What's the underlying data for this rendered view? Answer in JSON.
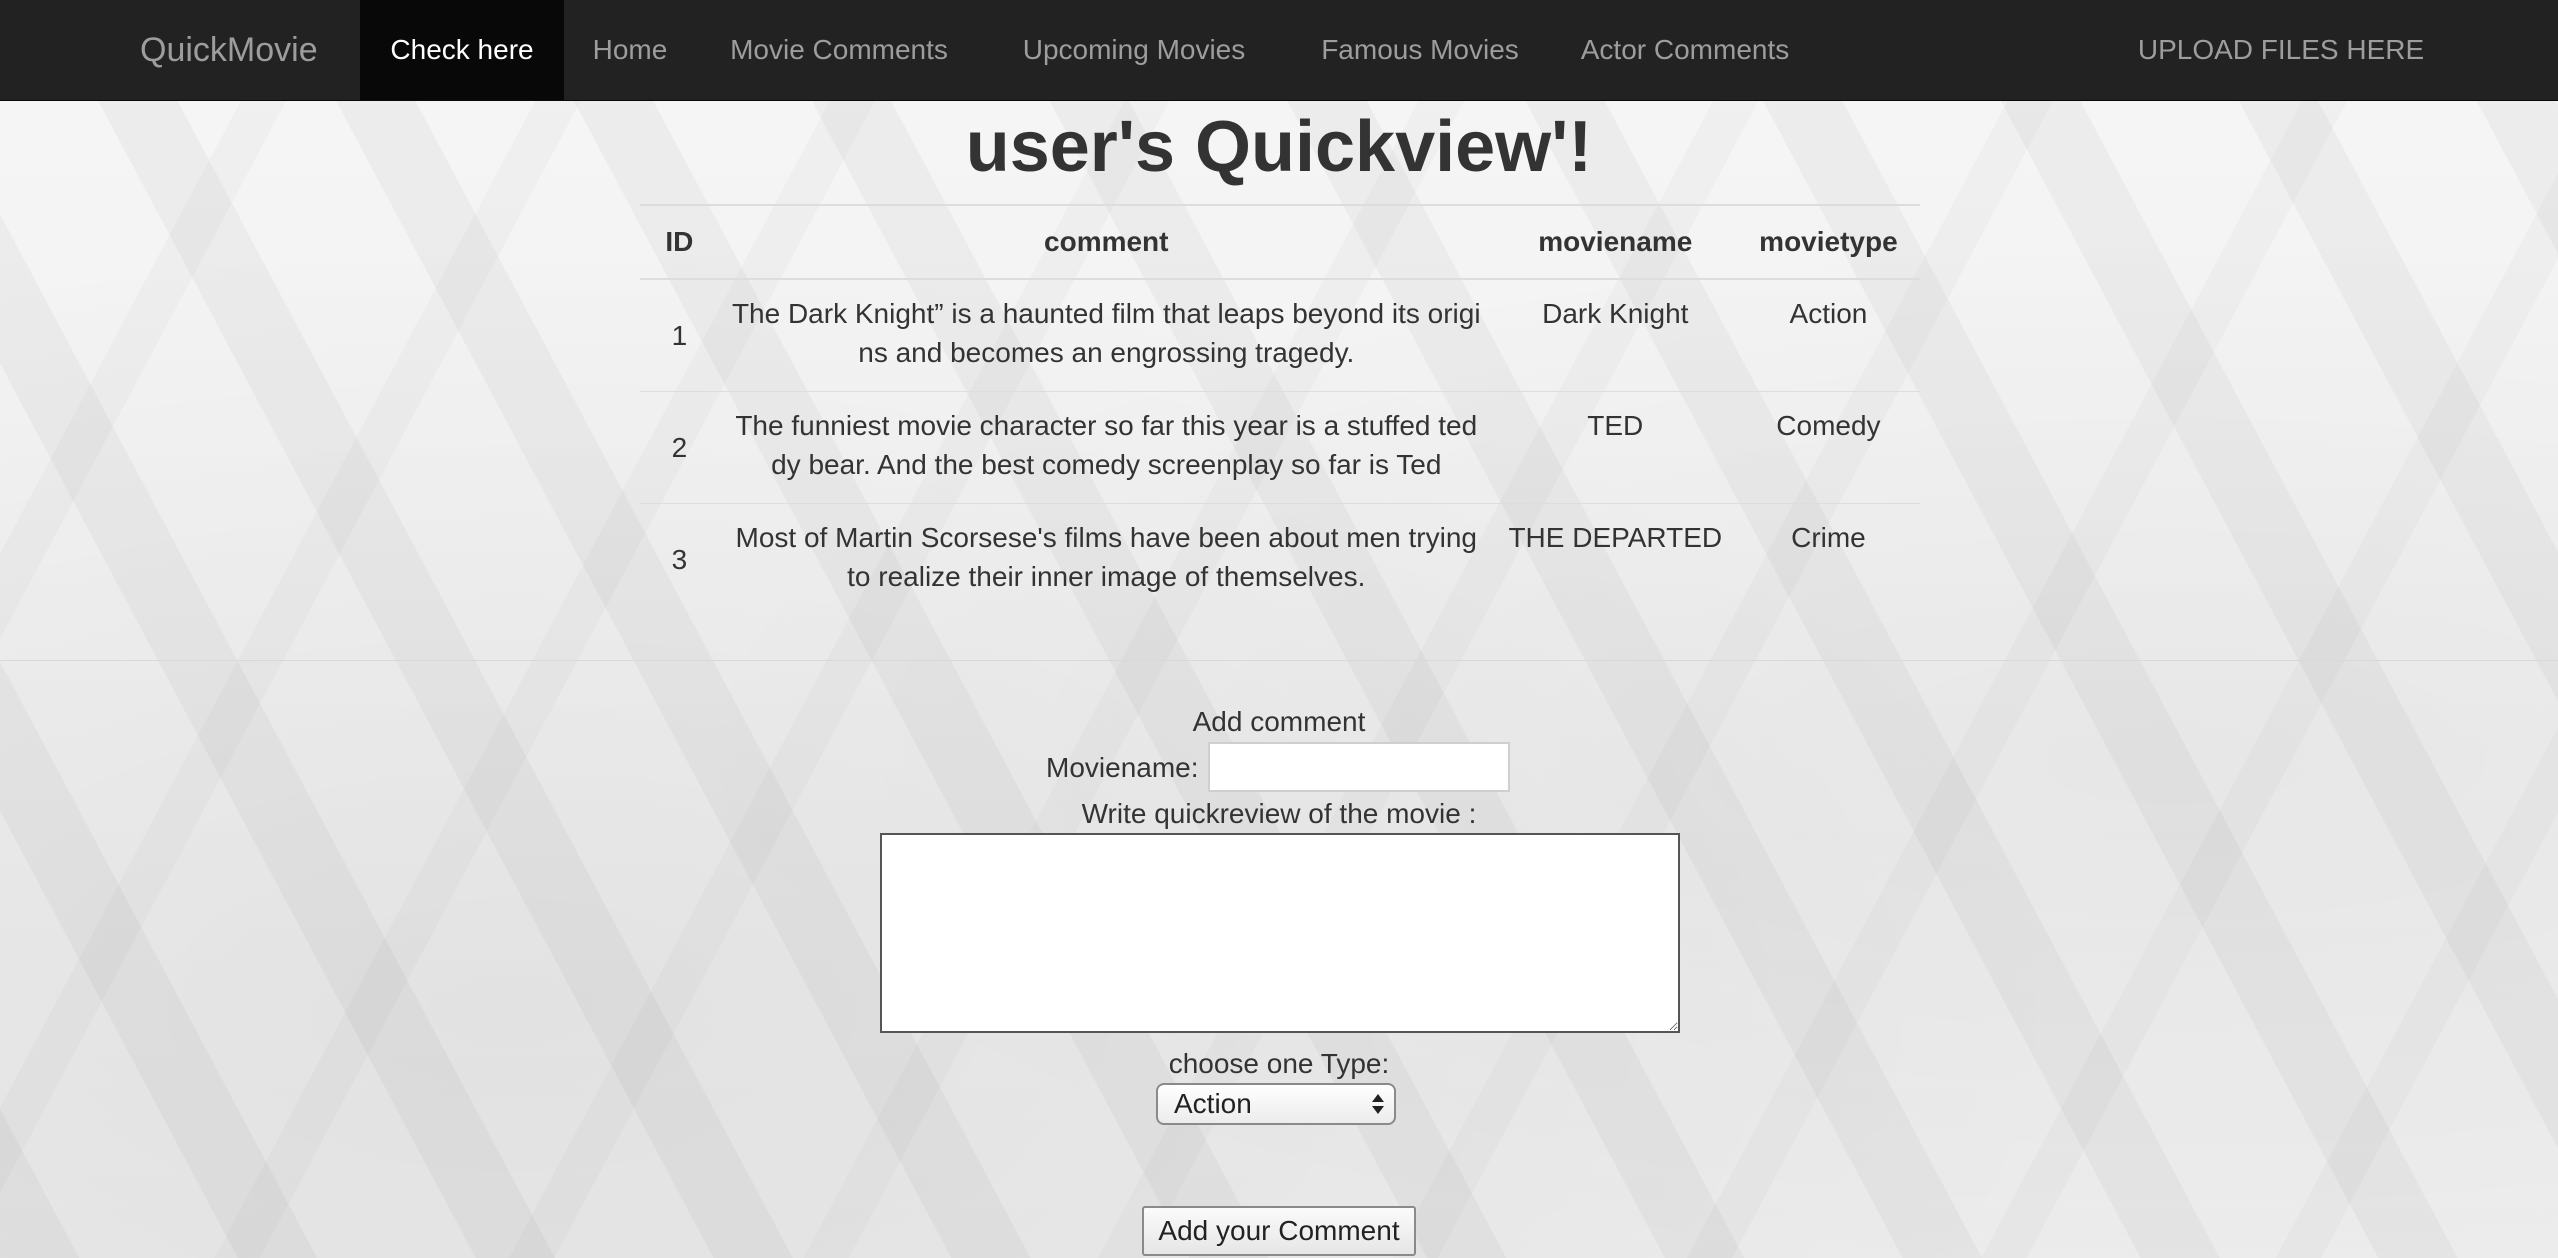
{
  "navbar": {
    "brand": "QuickMovie",
    "items": [
      {
        "label": "Check here",
        "active": true
      },
      {
        "label": "Home"
      },
      {
        "label": "Movie Comments"
      },
      {
        "label": "Upcoming Movies"
      },
      {
        "label": "Famous Movies"
      },
      {
        "label": "Actor Comments"
      }
    ],
    "upload_label": "UPLOAD FILES HERE"
  },
  "page": {
    "title": "user's Quickview'!"
  },
  "table": {
    "headers": [
      "ID",
      "comment",
      "moviename",
      "movietype"
    ],
    "rows": [
      {
        "id": "1",
        "comment": "The Dark Knight” is a haunted film that leaps beyond its origins and becomes an engrossing tragedy.",
        "moviename": "Dark Knight",
        "movietype": "Action"
      },
      {
        "id": "2",
        "comment": "The funniest movie character so far this year is a stuffed teddy bear. And the best comedy screenplay so far is Ted",
        "moviename": "TED",
        "movietype": "Comedy"
      },
      {
        "id": "3",
        "comment": "Most of Martin Scorsese's films have been about men trying to realize their inner image of themselves.",
        "moviename": "THE DEPARTED",
        "movietype": "Crime"
      }
    ]
  },
  "form": {
    "heading": "Add comment",
    "moviename_label": "Moviename:",
    "moviename_value": "",
    "review_label": "Write quickreview of the movie :",
    "review_value": "",
    "type_label": "choose one Type:",
    "type_selected": "Action",
    "submit_label": "Add your Comment"
  }
}
